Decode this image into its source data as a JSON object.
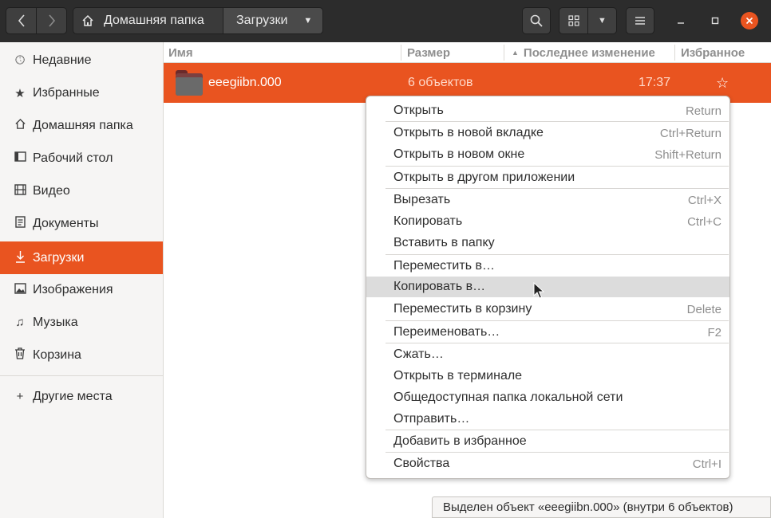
{
  "header": {
    "path_home_label": "Домашняя папка",
    "path_current_label": "Загрузки"
  },
  "sidebar": {
    "items": [
      {
        "label": "Недавние",
        "icon": "clock-icon"
      },
      {
        "label": "Избранные",
        "icon": "star-icon"
      },
      {
        "label": "Домашняя папка",
        "icon": "home-icon"
      },
      {
        "label": "Рабочий стол",
        "icon": "desktop-icon"
      },
      {
        "label": "Видео",
        "icon": "film-icon"
      },
      {
        "label": "Документы",
        "icon": "document-icon"
      },
      {
        "label": "Загрузки",
        "icon": "download-icon",
        "active": true
      },
      {
        "label": "Изображения",
        "icon": "image-icon"
      },
      {
        "label": "Музыка",
        "icon": "music-icon"
      },
      {
        "label": "Корзина",
        "icon": "trash-icon"
      }
    ],
    "other_places": {
      "label": "Другие места",
      "icon": "plus-icon"
    }
  },
  "columns": {
    "name": "Имя",
    "size": "Размер",
    "modified": "Последнее изменение",
    "favorite": "Избранное"
  },
  "file_row": {
    "name": "eeegiibn.000",
    "size": "6 объектов",
    "modified": "17:37",
    "icon": "folder-icon",
    "star": "☆"
  },
  "context_menu": {
    "items": [
      {
        "label": "Открыть",
        "accel": "Return"
      },
      {
        "label": "Открыть в новой вкладке",
        "accel": "Ctrl+Return"
      },
      {
        "label": "Открыть в новом окне",
        "accel": "Shift+Return"
      },
      {
        "label": "Открыть в другом приложении",
        "accel": ""
      },
      {
        "label": "Вырезать",
        "accel": "Ctrl+X"
      },
      {
        "label": "Копировать",
        "accel": "Ctrl+C"
      },
      {
        "label": "Вставить в папку",
        "accel": ""
      },
      {
        "label": "Переместить в…",
        "accel": ""
      },
      {
        "label": "Копировать в…",
        "accel": "",
        "highlighted": true
      },
      {
        "label": "Переместить в корзину",
        "accel": "Delete"
      },
      {
        "label": "Переименовать…",
        "accel": "F2"
      },
      {
        "label": "Сжать…",
        "accel": ""
      },
      {
        "label": "Открыть в терминале",
        "accel": ""
      },
      {
        "label": "Общедоступная папка локальной сети",
        "accel": ""
      },
      {
        "label": "Отправить…",
        "accel": ""
      },
      {
        "label": "Добавить в избранное",
        "accel": ""
      },
      {
        "label": "Свойства",
        "accel": "Ctrl+I"
      }
    ]
  },
  "statusbar": {
    "text": "Выделен объект «eeegiibn.000» (внутри 6 объектов)"
  },
  "colors": {
    "accent": "#e95420",
    "headerbar": "#2c2c2c",
    "sidebar_bg": "#f6f5f4"
  }
}
